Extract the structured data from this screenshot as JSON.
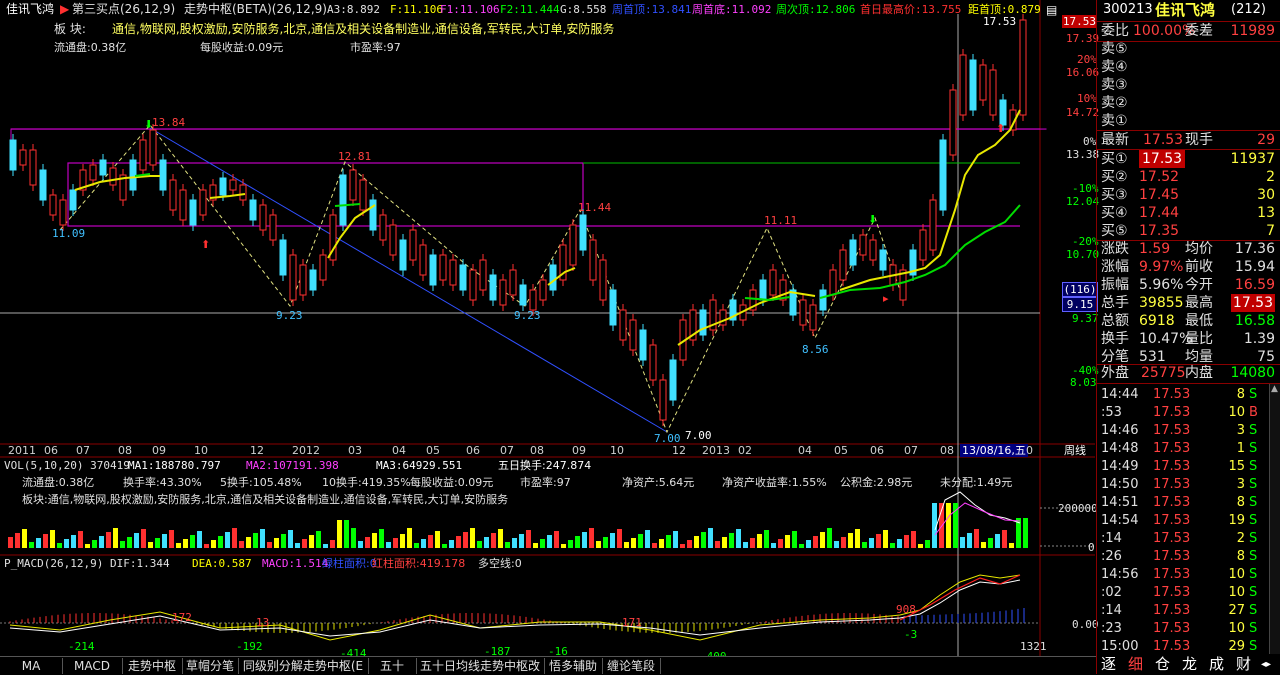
{
  "header": {
    "stock_name": "佳讯飞鸿",
    "indicator1": "第三买点(26,12,9)",
    "indicator2": "走势中枢(BETA)(26,12,9)",
    "a3": "A3:8.892",
    "f": "F:11.106",
    "f1": "F1:11.106",
    "f2": "F2:11.444",
    "g": "G:8.558",
    "week_top": "周首顶:13.841",
    "week_bottom": "周首底:11.092",
    "week_next_top": "周次顶:12.806",
    "first_day_high": "首日最高价:13.755",
    "dist_top": "距首顶:0.879",
    "sector_label": "板  块:",
    "sector": "通信,物联网,股权激励,安防服务,北京,通信及相关设备制造业,通信设备,军转民,大订单,安防服务",
    "float_share": "流通盘:0.38亿",
    "eps": "每股收益:0.09元",
    "pe": "市盈率:97"
  },
  "price_chart": {
    "right_axis": [
      "17.53",
      "17.39",
      "20%",
      "16.06",
      "10%",
      "14.72",
      "0%",
      "13.38",
      "-10%",
      "12.04",
      "-20%",
      "10.70",
      "(116)",
      "9.15",
      "9.37",
      "-40%",
      "8.03"
    ],
    "annotations": [
      "13.84",
      "11.09",
      "12.81",
      "9.23",
      "11.44",
      "9.23",
      "7.00",
      "7.00",
      "11.11",
      "8.56",
      "17.53"
    ],
    "date_axis": [
      "2011",
      "06",
      "07",
      "08",
      "09",
      "10",
      "12",
      "2012",
      "03",
      "04",
      "05",
      "06",
      "07",
      "08",
      "09",
      "10",
      "12",
      "2013",
      "02",
      "04",
      "05",
      "06",
      "07",
      "08",
      "13/08/16,五",
      "0"
    ],
    "period": "周线"
  },
  "volume": {
    "header": "VOL(5,10,20)  370419",
    "ma1": "MA1:188780.797",
    "ma2": "MA2:107191.398",
    "ma3": "MA3:64929.551",
    "turnover5": "五日换手:247.874",
    "info1": [
      "流通盘:0.38亿",
      "换手率:43.30%",
      "5换手:105.48%",
      "10换手:419.35%",
      "每股收益:0.09元",
      "市盈率:97",
      "净资产:5.64元",
      "净资产收益率:1.55%",
      "公积金:2.98元",
      "未分配:1.49元"
    ],
    "info2": "板块:通信,物联网,股权激励,安防服务,北京,通信及相关设备制造业,通信设备,军转民,大订单,安防服务",
    "axis": [
      "200000",
      "100000",
      "0"
    ]
  },
  "macd": {
    "header": "P_MACD(26,12,9)",
    "dif": "DIF:1.344",
    "dea": "DEA:0.587",
    "macd": "MACD:1.514",
    "green_area": "绿柱面积:0",
    "red_area": "红柱面积:419.178",
    "long_short": "多空线:0",
    "labels": [
      "-214",
      "172",
      "-192",
      "13",
      "-414",
      "-187",
      "-16",
      "171",
      "-400",
      "908",
      "-3",
      "1321"
    ],
    "axis": "0.00"
  },
  "bottom_tabs": [
    "MA",
    "MACD",
    "走势中枢",
    "草帽分笔",
    "同级别分解走势中枢(E",
    "五十",
    "五十日均线走势中枢改",
    "悟多辅助",
    "缠论笔段"
  ],
  "right_panel": {
    "code": "300213",
    "name": "佳讯飞鸿",
    "num": "(212)",
    "commission_ratio_label": "委比",
    "commission_ratio": "100.00%",
    "commission_diff_label": "委差",
    "commission_diff": "11989",
    "sells": [
      "卖⑤",
      "卖④",
      "卖③",
      "卖②",
      "卖①"
    ],
    "last_label": "最新",
    "last": "17.53",
    "hand_label": "现手",
    "hand": "29",
    "buys": [
      {
        "label": "买①",
        "price": "17.53",
        "vol": "11937"
      },
      {
        "label": "买②",
        "price": "17.52",
        "vol": "2"
      },
      {
        "label": "买③",
        "price": "17.45",
        "vol": "30"
      },
      {
        "label": "买④",
        "price": "17.44",
        "vol": "13"
      },
      {
        "label": "买⑤",
        "price": "17.35",
        "vol": "7"
      }
    ],
    "stats": [
      {
        "l1": "涨跌",
        "v1": "1.59",
        "l2": "均价",
        "v2": "17.36"
      },
      {
        "l1": "涨幅",
        "v1": "9.97%",
        "l2": "前收",
        "v2": "15.94"
      },
      {
        "l1": "振幅",
        "v1": "5.96%",
        "l2": "今开",
        "v2": "16.59"
      },
      {
        "l1": "总手",
        "v1": "39855",
        "l2": "最高",
        "v2": "17.53"
      },
      {
        "l1": "总额",
        "v1": "6918",
        "l2": "最低",
        "v2": "16.58"
      },
      {
        "l1": "换手",
        "v1": "10.47%",
        "l2": "量比",
        "v2": "1.39"
      },
      {
        "l1": "分笔",
        "v1": "531",
        "l2": "均量",
        "v2": "75"
      }
    ],
    "outer_label": "外盘",
    "outer": "25775",
    "inner_label": "内盘",
    "inner": "14080",
    "ticks": [
      {
        "t": "14:44",
        "p": "17.53",
        "v": "8",
        "s": "S"
      },
      {
        "t": ":53",
        "p": "17.53",
        "v": "10",
        "s": "B"
      },
      {
        "t": "14:46",
        "p": "17.53",
        "v": "3",
        "s": "S"
      },
      {
        "t": "14:48",
        "p": "17.53",
        "v": "1",
        "s": "S"
      },
      {
        "t": "14:49",
        "p": "17.53",
        "v": "15",
        "s": "S"
      },
      {
        "t": "14:50",
        "p": "17.53",
        "v": "3",
        "s": "S"
      },
      {
        "t": "14:51",
        "p": "17.53",
        "v": "8",
        "s": "S"
      },
      {
        "t": "14:54",
        "p": "17.53",
        "v": "19",
        "s": "S"
      },
      {
        "t": ":14",
        "p": "17.53",
        "v": "2",
        "s": "S"
      },
      {
        "t": ":26",
        "p": "17.53",
        "v": "8",
        "s": "S"
      },
      {
        "t": "14:56",
        "p": "17.53",
        "v": "10",
        "s": "S"
      },
      {
        "t": ":02",
        "p": "17.53",
        "v": "10",
        "s": "S"
      },
      {
        "t": ":14",
        "p": "17.53",
        "v": "27",
        "s": "S"
      },
      {
        "t": ":23",
        "p": "17.53",
        "v": "10",
        "s": "S"
      },
      {
        "t": "15:00",
        "p": "17.53",
        "v": "29",
        "s": "S"
      }
    ],
    "tabs": [
      "逐",
      "细",
      "仓",
      "龙",
      "成",
      "财"
    ]
  }
}
